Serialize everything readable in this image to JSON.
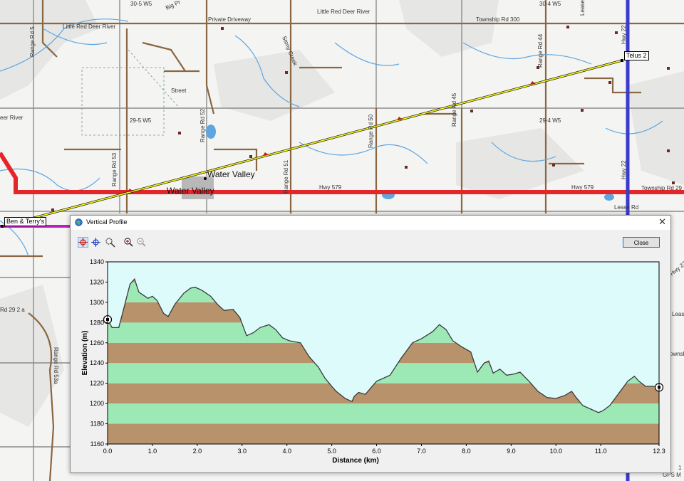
{
  "map": {
    "labels": {
      "twp_30_5_w5": "30-5 W5",
      "big_pr": "Big Pr",
      "private_driveway": "Private Driveway",
      "little_red_deer_river_top": "Little Red Deer River",
      "township_rd_300": "Township Rd 300",
      "twp_30_4_w5": "30-4 W5",
      "lease_rd_top": "Lease R",
      "little_red_deer_river_left": "Little Red Deer River",
      "range_rd_5x": "Range Rd 5",
      "stony_creek": "Stony Creek",
      "telus_2": "Telus 2",
      "range_rd_44": "Range Rd 44",
      "hwy_22_top": "Hwy 22",
      "street": "Street",
      "range_rd_45": "Range Rd 45",
      "deer_river": "eer River",
      "twp_29_5_w5": "29-5 W5",
      "range_rd_52": "Range Rd 52",
      "range_rd_50": "Range Rd 50",
      "twp_29_4_w5": "29-4 W5",
      "range_rd_53": "Range Rd 53",
      "water_valley_town": "Water Valley",
      "range_rd_51": "Range Rd 51",
      "hwy_22_mid": "Hwy 22",
      "water_valley_road": "Water Valley",
      "hwy_579_mid": "Hwy 579",
      "hwy_579_right": "Hwy 579",
      "township_rd_29": "Township Rd 29",
      "ben_terrys": "Ben & Terry's",
      "lease_rd": "Lease Rd",
      "rd_292a": "Rd 29 2 a",
      "range_rd_53a": "Range Rd 53a",
      "hwy_22_right": "Hwy 22",
      "lease_right": "Lease",
      "township_right": "ownship",
      "gps_m": "GPS M",
      "one": "1"
    }
  },
  "dialog": {
    "title": "Vertical Profile",
    "close_button": "Close"
  },
  "chart_data": {
    "type": "area",
    "xlabel": "Distance  (km)",
    "ylabel": "Elevation (m)",
    "xlim": [
      0,
      12.3
    ],
    "ylim": [
      1160,
      1340
    ],
    "x_ticks": [
      "0.0",
      "1.0",
      "2.0",
      "3.0",
      "4.0",
      "5.0",
      "6.0",
      "7.0",
      "8.0",
      "9.0",
      "10.0",
      "11.0",
      "12.3"
    ],
    "y_ticks": [
      "1340",
      "1320",
      "1300",
      "1280",
      "1260",
      "1240",
      "1220",
      "1200",
      "1180",
      "1160"
    ],
    "band_colors": [
      "#b8926a",
      "#9de9b6"
    ],
    "band_step": 20,
    "sky_color": "#ddfbfb",
    "line_color": "#3a3a3a",
    "x": [
      0,
      0.1,
      0.25,
      0.35,
      0.5,
      0.6,
      0.7,
      0.9,
      1.0,
      1.1,
      1.25,
      1.35,
      1.5,
      1.7,
      1.85,
      1.95,
      2.1,
      2.3,
      2.45,
      2.6,
      2.8,
      2.95,
      3.1,
      3.25,
      3.4,
      3.6,
      3.75,
      3.9,
      4.05,
      4.3,
      4.5,
      4.7,
      4.85,
      5.0,
      5.1,
      5.3,
      5.45,
      5.5,
      5.6,
      5.75,
      5.9,
      6.0,
      6.3,
      6.55,
      6.8,
      7.0,
      7.25,
      7.4,
      7.55,
      7.7,
      7.9,
      8.1,
      8.25,
      8.4,
      8.5,
      8.6,
      8.75,
      8.9,
      9.05,
      9.2,
      9.4,
      9.6,
      9.8,
      10.0,
      10.2,
      10.35,
      10.45,
      10.6,
      10.8,
      10.95,
      11.05,
      11.2,
      11.45,
      11.6,
      11.75,
      11.85,
      12.0,
      12.15,
      12.3
    ],
    "values": [
      1283,
      1275,
      1275,
      1292,
      1318,
      1323,
      1310,
      1304,
      1306,
      1302,
      1289,
      1286,
      1298,
      1309,
      1314,
      1315,
      1312,
      1306,
      1298,
      1292,
      1293,
      1285,
      1267,
      1270,
      1275,
      1278,
      1273,
      1265,
      1262,
      1260,
      1246,
      1236,
      1225,
      1217,
      1212,
      1205,
      1202,
      1207,
      1211,
      1209,
      1217,
      1222,
      1228,
      1245,
      1260,
      1264,
      1271,
      1278,
      1273,
      1262,
      1256,
      1251,
      1231,
      1240,
      1242,
      1230,
      1234,
      1228,
      1229,
      1231,
      1222,
      1212,
      1206,
      1205,
      1208,
      1212,
      1206,
      1198,
      1194,
      1191,
      1193,
      1198,
      1213,
      1222,
      1227,
      1222,
      1217,
      1217,
      1216
    ],
    "endpoint_start": 1283,
    "endpoint_end": 1216
  }
}
